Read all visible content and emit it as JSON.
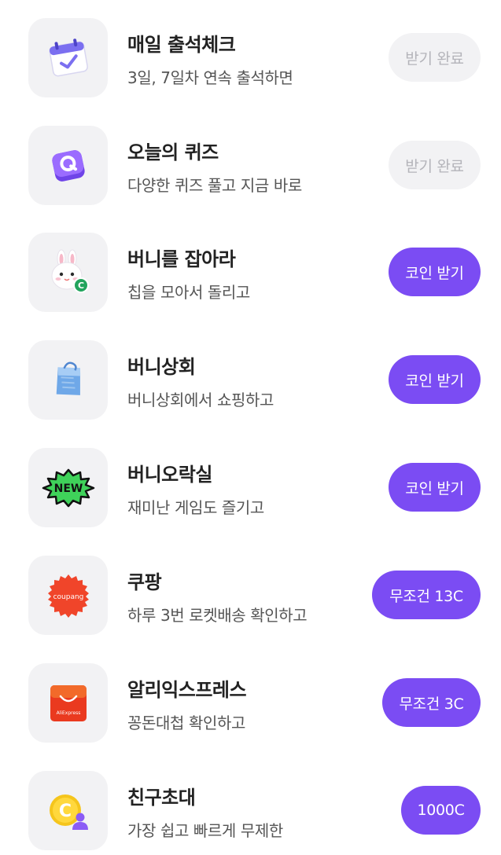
{
  "missions": [
    {
      "id": "attendance",
      "title": "매일 출석체크",
      "subtitle": "3일, 7일차 연속 출석하면",
      "button": "받기 완료",
      "button_state": "done",
      "icon": "calendar-icon"
    },
    {
      "id": "quiz",
      "title": "오늘의 퀴즈",
      "subtitle": "다양한 퀴즈 풀고 지금 바로",
      "button": "받기 완료",
      "button_state": "done",
      "icon": "quiz-icon"
    },
    {
      "id": "catch-bunny",
      "title": "버니를 잡아라",
      "subtitle": "칩을 모아서 돌리고",
      "button": "코인 받기",
      "button_state": "active",
      "icon": "bunny-icon"
    },
    {
      "id": "bunny-store",
      "title": "버니상회",
      "subtitle": "버니상회에서 쇼핑하고",
      "button": "코인 받기",
      "button_state": "active",
      "icon": "shopping-bag-icon"
    },
    {
      "id": "bunny-arcade",
      "title": "버니오락실",
      "subtitle": "재미난 게임도 즐기고",
      "button": "코인 받기",
      "button_state": "active",
      "icon": "new-badge-icon",
      "badge_text": "NEW"
    },
    {
      "id": "coupang",
      "title": "쿠팡",
      "subtitle": "하루 3번 로켓배송 확인하고",
      "button": "무조건 13C",
      "button_state": "active",
      "icon": "coupang-logo-icon",
      "logo_text": "coupang"
    },
    {
      "id": "aliexpress",
      "title": "알리익스프레스",
      "subtitle": "꽁돈대첩 확인하고",
      "button": "무조건 3C",
      "button_state": "active",
      "icon": "aliexpress-logo-icon",
      "logo_text": "AliExpress"
    },
    {
      "id": "invite",
      "title": "친구초대",
      "subtitle": "가장 쉽고 빠르게 무제한",
      "button": "1000C",
      "button_state": "active",
      "icon": "invite-coin-icon"
    }
  ],
  "colors": {
    "accent": "#7b4cf3",
    "done_bg": "#f2f2f4",
    "done_text": "#b4b4ba",
    "icon_bg": "#f2f2f4"
  }
}
